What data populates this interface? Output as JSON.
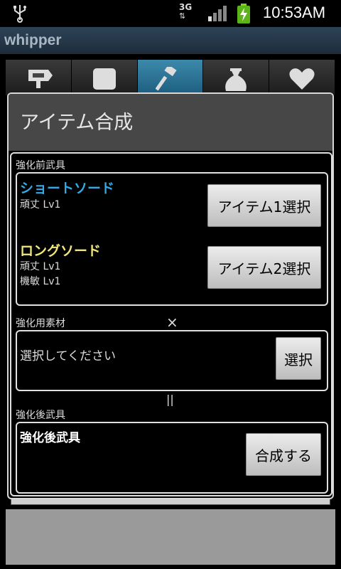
{
  "status_bar": {
    "time": "10:53AM",
    "network": "3G"
  },
  "app": {
    "title": "whipper"
  },
  "tabs": [
    {
      "icon": "signpost-icon",
      "active": false
    },
    {
      "icon": "square-icon",
      "active": false
    },
    {
      "icon": "hammer-icon",
      "active": true
    },
    {
      "icon": "money-bag-icon",
      "active": false
    },
    {
      "icon": "heart-icon",
      "active": false
    }
  ],
  "dialog": {
    "title": "アイテム合成",
    "before": {
      "label": "強化前武具",
      "item1": {
        "name": "ショートソード",
        "color": "#33a9e6",
        "stats": [
          "頑丈 Lv1"
        ],
        "button": "アイテム1選択"
      },
      "item2": {
        "name": "ロングソード",
        "color": "#f0e67a",
        "stats": [
          "頑丈 Lv1",
          "機敏 Lv1"
        ],
        "button": "アイテム2選択"
      }
    },
    "times_symbol": "×",
    "material": {
      "label": "強化用素材",
      "placeholder_text": "選択してください",
      "button": "選択"
    },
    "equals_symbol": "||",
    "after": {
      "label": "強化後武具",
      "result_text": "強化後武具",
      "button": "合成する"
    }
  }
}
